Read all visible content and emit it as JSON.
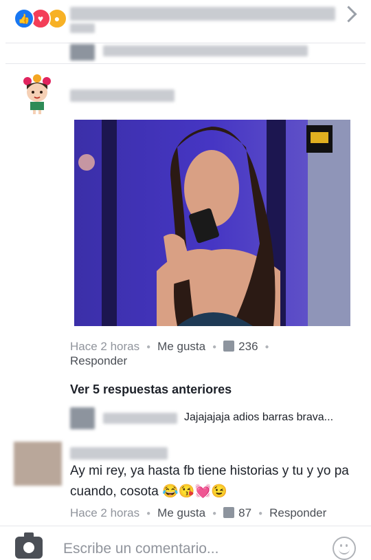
{
  "header": {
    "reactions": [
      "like-icon",
      "love-icon",
      "wow-icon"
    ],
    "colors": {
      "like": "#1877f2",
      "love": "#f33e58",
      "wow": "#f7b125"
    }
  },
  "comment1": {
    "meta": {
      "time": "Hace 2 horas",
      "like_label": "Me gusta",
      "like_count": "236",
      "reply_label": "Responder"
    }
  },
  "replies": {
    "see_more": "Ver 5 respuestas anteriores",
    "preview_text": "Jajajajaja adios barras brava..."
  },
  "comment2": {
    "text": "Ay mi rey, ya hasta fb tiene historias y tu y yo pa cuando, cosota 😂😘💓😉",
    "meta": {
      "time": "Hace 2 horas",
      "like_label": "Me gusta",
      "like_count": "87",
      "reply_label": "Responder"
    }
  },
  "compose": {
    "placeholder": "Escribe un comentario..."
  }
}
